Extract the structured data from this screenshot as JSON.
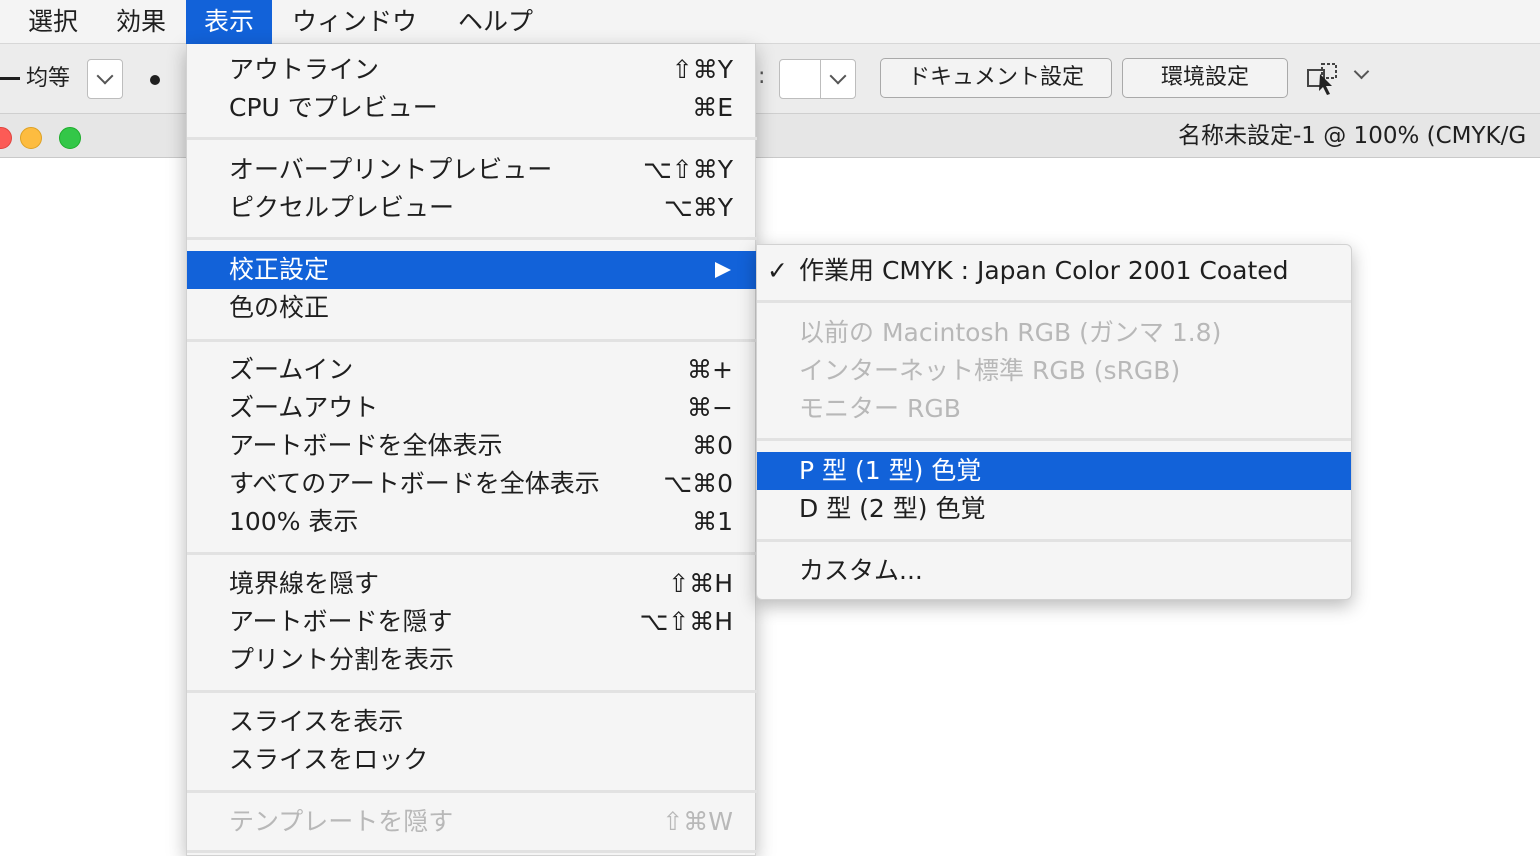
{
  "menubar": {
    "items": [
      {
        "label": "選択"
      },
      {
        "label": "効果"
      },
      {
        "label": "表示"
      },
      {
        "label": "ウィンドウ"
      },
      {
        "label": "ヘルプ"
      }
    ]
  },
  "controlbar": {
    "stroke_profile": "均等",
    "colon": ":",
    "document_setup_button": "ドキュメント設定",
    "preferences_button": "環境設定"
  },
  "titlebar": {
    "document_title": "名称未設定-1 @ 100% (CMYK/G"
  },
  "view_menu": {
    "items": [
      {
        "label": "アウトライン",
        "shortcut": "⇧⌘Y"
      },
      {
        "label": "CPU でプレビュー",
        "shortcut": "⌘E"
      },
      {
        "label": "オーバープリントプレビュー",
        "shortcut": "⌥⇧⌘Y"
      },
      {
        "label": "ピクセルプレビュー",
        "shortcut": "⌥⌘Y"
      },
      {
        "label": "校正設定",
        "shortcut": ""
      },
      {
        "label": "色の校正",
        "shortcut": ""
      },
      {
        "label": "ズームイン",
        "shortcut": "⌘+"
      },
      {
        "label": "ズームアウト",
        "shortcut": "⌘−"
      },
      {
        "label": "アートボードを全体表示",
        "shortcut": "⌘0"
      },
      {
        "label": "すべてのアートボードを全体表示",
        "shortcut": "⌥⌘0"
      },
      {
        "label": "100% 表示",
        "shortcut": "⌘1"
      },
      {
        "label": "境界線を隠す",
        "shortcut": "⇧⌘H"
      },
      {
        "label": "アートボードを隠す",
        "shortcut": "⌥⇧⌘H"
      },
      {
        "label": "プリント分割を表示",
        "shortcut": ""
      },
      {
        "label": "スライスを表示",
        "shortcut": ""
      },
      {
        "label": "スライスをロック",
        "shortcut": ""
      },
      {
        "label": "テンプレートを隠す",
        "shortcut": "⇧⌘W"
      }
    ]
  },
  "proof_submenu": {
    "check_mark": "✓",
    "items": [
      {
        "label": "作業用 CMYK : Japan Color 2001 Coated"
      },
      {
        "label": "以前の Macintosh RGB (ガンマ 1.8)"
      },
      {
        "label": "インターネット標準 RGB (sRGB)"
      },
      {
        "label": "モニター RGB"
      },
      {
        "label": "P 型 (1 型) 色覚"
      },
      {
        "label": "D 型 (2 型) 色覚"
      },
      {
        "label": "カスタム..."
      }
    ]
  },
  "colors": {
    "highlight": "#1262d9",
    "disabled_text": "#b8b8b8",
    "menu_bg": "#f5f5f5"
  }
}
